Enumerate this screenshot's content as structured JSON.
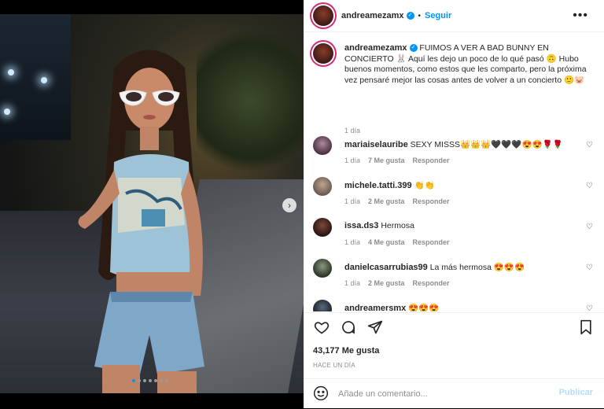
{
  "post": {
    "username": "andreamezamx",
    "follow_label": "Seguir",
    "more_label": "•••",
    "next_label": "›",
    "carousel_count": 7,
    "carousel_active": 0
  },
  "caption": {
    "username": "andreamezamx",
    "text": "FUIMOS A VER A BAD BUNNY EN CONCIERTO 🐰 Aquí les dejo un poco de lo qué pasó 🙃 Hubo buenos momentos, como estos que les comparto, pero la próxima vez pensaré mejor las cosas antes de volver a un concierto 🙂🐷",
    "time": "1 día"
  },
  "comments": [
    {
      "username": "mariaiselauribe",
      "text": "SEXY MISSS👑👑👑🖤🖤🖤😍😍🌹🌹",
      "time": "1 día",
      "likes": "7 Me gusta",
      "reply": "Responder"
    },
    {
      "username": "michele.tatti.399",
      "text": "👏👏",
      "time": "1 día",
      "likes": "2 Me gusta",
      "reply": "Responder"
    },
    {
      "username": "issa.ds3",
      "text": "Hermosa",
      "time": "1 día",
      "likes": "4 Me gusta",
      "reply": "Responder"
    },
    {
      "username": "danielcasarrubias99",
      "text": "La más hermosa 😍😍😍",
      "time": "1 día",
      "likes": "2 Me gusta",
      "reply": "Responder"
    },
    {
      "username": "andreamersmx",
      "text": "😍😍😍",
      "time": "",
      "likes": "",
      "reply": ""
    }
  ],
  "footer": {
    "likes": "43,177 Me gusta",
    "posted": "HACE UN DÍA",
    "comment_placeholder": "Añade un comentario...",
    "publish_label": "Publicar"
  },
  "colors": {
    "accent": "#0095f6",
    "ring": "#d62976",
    "muted": "#8e8e8e"
  }
}
